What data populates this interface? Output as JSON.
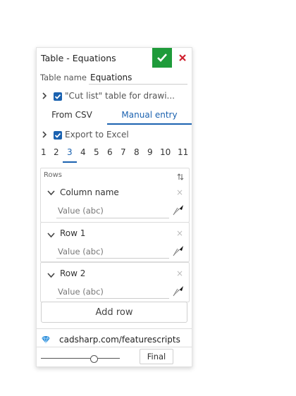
{
  "panel": {
    "title": "Table - Equations",
    "confirm_icon": "check-icon",
    "cancel_icon": "close-icon"
  },
  "table_name": {
    "label": "Table name",
    "value": "Equations"
  },
  "cut_list": {
    "label": "\"Cut list\" table for drawi..."
  },
  "tabs": {
    "items": [
      "From CSV",
      "Manual entry"
    ],
    "active": "Manual entry"
  },
  "export": {
    "label": "Export to Excel"
  },
  "number_tabs": {
    "items": [
      "1",
      "2",
      "3",
      "4",
      "5",
      "6",
      "7",
      "8",
      "9",
      "10",
      "11"
    ],
    "active": "3"
  },
  "rows_section": {
    "header": "Rows",
    "column_name": {
      "label": "Column name",
      "placeholder": "Value (abc)"
    },
    "rows": [
      {
        "label": "Row 1",
        "placeholder": "Value (abc)"
      },
      {
        "label": "Row 2",
        "placeholder": "Value (abc)"
      }
    ],
    "add_row_label": "Add row"
  },
  "footer": {
    "link_text": "cadsharp.com/featurescripts",
    "slider_value": 0.67,
    "final_label": "Final"
  },
  "colors": {
    "accent": "#1b62b0",
    "confirm": "#1e9b3a",
    "cancel": "#d0202e"
  }
}
